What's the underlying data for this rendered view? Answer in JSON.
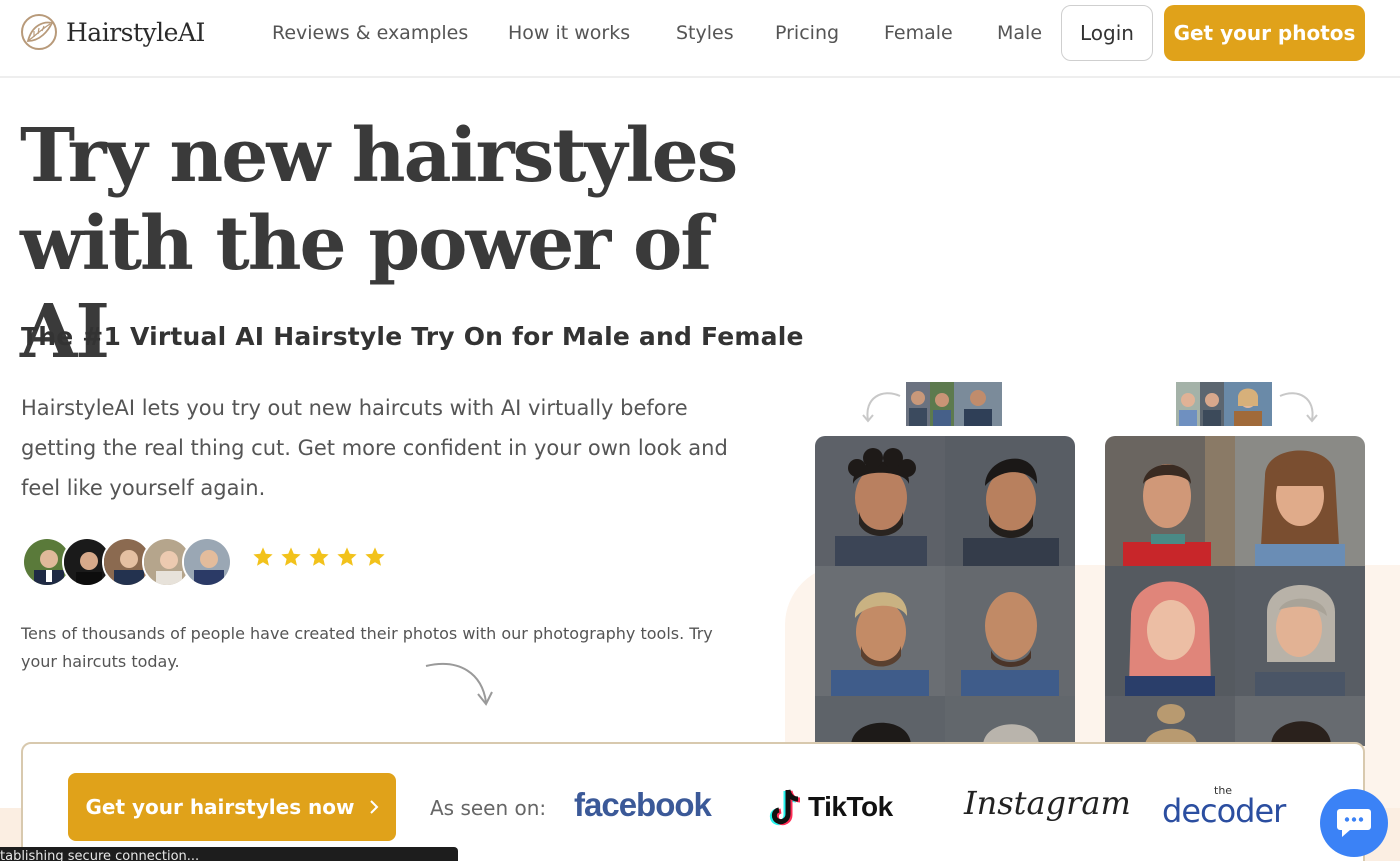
{
  "brand": {
    "name": "HairstyleAI",
    "accent": "#e0a21a"
  },
  "nav": {
    "links": [
      "Reviews & examples",
      "How it works",
      "Styles",
      "Pricing",
      "Female",
      "Male"
    ],
    "login": "Login",
    "cta": "Get your photos"
  },
  "hero": {
    "title_line1": "Try new hairstyles",
    "title_line2": "with the power of AI",
    "subtitle": "The #1 Virtual AI Hairstyle Try On for Male and Female",
    "description": "HairstyleAI lets you try out new haircuts with AI virtually before getting the real thing cut. Get more confident in your own look and feel like yourself again.",
    "rating_stars": 5,
    "social_proof": "Tens of thousands of people have created their photos with our photography tools. Try your haircuts today."
  },
  "bottom": {
    "cta": "Get your hairstyles now",
    "seen_on": "As seen on:",
    "brands": {
      "facebook": "facebook",
      "tiktok": "TikTok",
      "instagram": "Instagram",
      "decoder_small": "the",
      "decoder": "decoder"
    }
  },
  "status_text": "tablishing secure connection..."
}
